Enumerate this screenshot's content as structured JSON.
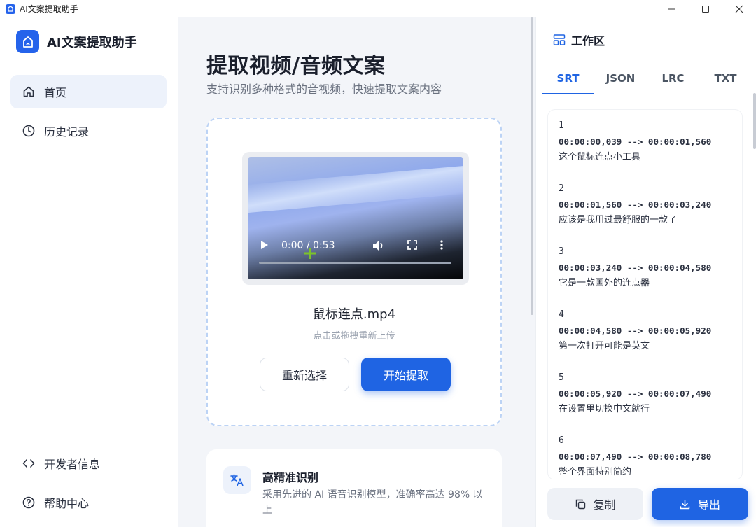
{
  "window": {
    "title": "AI文案提取助手"
  },
  "sidebar": {
    "app_name": "AI文案提取助手",
    "nav": [
      {
        "label": "首页",
        "icon": "home-icon",
        "active": true
      },
      {
        "label": "历史记录",
        "icon": "clock-icon",
        "active": false
      }
    ],
    "bottom_nav": [
      {
        "label": "开发者信息",
        "icon": "code-icon"
      },
      {
        "label": "帮助中心",
        "icon": "help-icon"
      }
    ]
  },
  "main": {
    "title": "提取视频/音频文案",
    "subtitle": "支持识别多种格式的音视频，快速提取文案内容",
    "video": {
      "time_display": "0:00 / 0:53"
    },
    "filename": "鼠标连点.mp4",
    "upload_hint": "点击或拖拽重新上传",
    "reselect_label": "重新选择",
    "extract_label": "开始提取",
    "feature": {
      "title": "高精准识别",
      "description": "采用先进的 AI 语音识别模型，准确率高达 98% 以上",
      "icon": "translate-icon"
    }
  },
  "workspace": {
    "title": "工作区",
    "tabs": [
      "SRT",
      "JSON",
      "LRC",
      "TXT"
    ],
    "active_tab": "SRT",
    "srt_entries": [
      {
        "index": "1",
        "time": "00:00:00,039 --> 00:00:01,560",
        "text": "这个鼠标连点小工具"
      },
      {
        "index": "2",
        "time": "00:00:01,560 --> 00:00:03,240",
        "text": "应该是我用过最舒服的一款了"
      },
      {
        "index": "3",
        "time": "00:00:03,240 --> 00:00:04,580",
        "text": "它是一款国外的连点器"
      },
      {
        "index": "4",
        "time": "00:00:04,580 --> 00:00:05,920",
        "text": "第一次打开可能是英文"
      },
      {
        "index": "5",
        "time": "00:00:05,920 --> 00:00:07,490",
        "text": "在设置里切换中文就行"
      },
      {
        "index": "6",
        "time": "00:00:07,490 --> 00:00:08,780",
        "text": "整个界面特别简约"
      }
    ],
    "copy_label": "复制",
    "export_label": "导出"
  },
  "colors": {
    "accent": "#1f64e3",
    "sidebar_active_bg": "#edf2fb",
    "background": "#f3f5f9"
  }
}
